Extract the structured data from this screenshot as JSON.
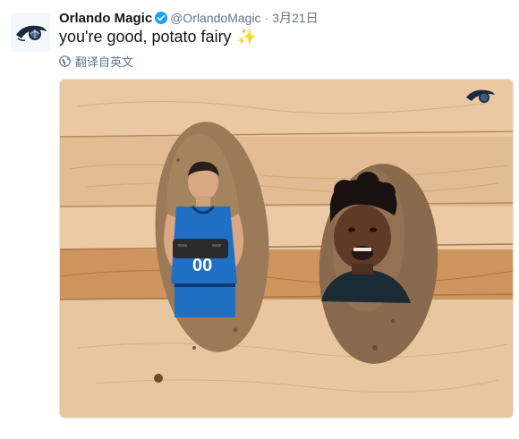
{
  "tweet": {
    "display_name": "Orlando Magic",
    "handle": "@OrlandoMagic",
    "separator": "·",
    "timestamp": "3月21日",
    "text": "you're good, potato fairy",
    "text_emoji": "✨",
    "translate_label": "翻译自英文",
    "icons": {
      "avatar": "orlando-magic-logo",
      "verified": "verified-badge-icon",
      "translate": "globe-icon",
      "watermark": "orlando-magic-logo"
    },
    "colors": {
      "verified": "#1da1f2",
      "secondary_text": "#657786",
      "wood": "#e2b98f",
      "potato": "#9c7a58",
      "jersey": "#1f6fc4"
    }
  }
}
